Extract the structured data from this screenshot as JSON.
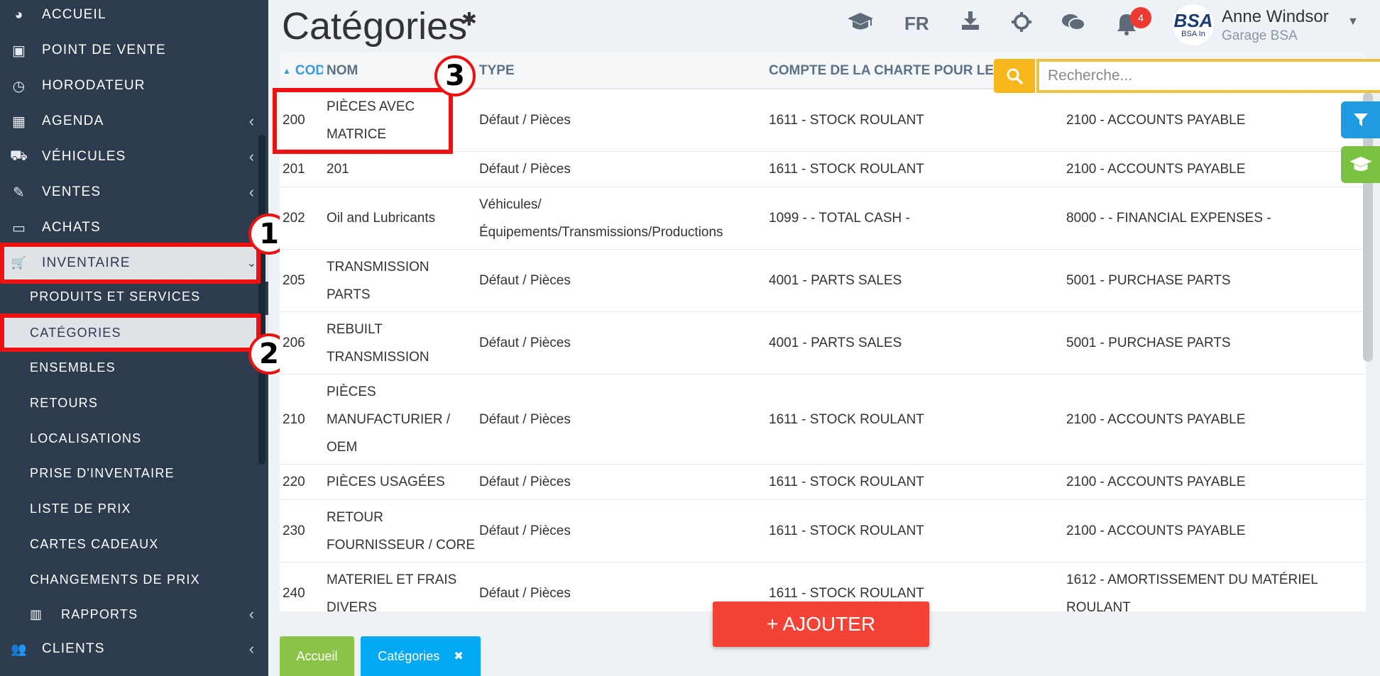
{
  "sidebar": {
    "items": [
      {
        "label": "ACCUEIL",
        "icon": "dashboard-icon",
        "glyph": "◕"
      },
      {
        "label": "POINT DE VENTE",
        "icon": "cash-icon",
        "glyph": "▣"
      },
      {
        "label": "HORODATEUR",
        "icon": "clock-icon",
        "glyph": "◷"
      },
      {
        "label": "AGENDA",
        "icon": "calendar-icon",
        "glyph": "▦"
      },
      {
        "label": "VÉHICULES",
        "icon": "car-icon",
        "glyph": "⛟"
      },
      {
        "label": "VENTES",
        "icon": "edit-icon",
        "glyph": "✎"
      },
      {
        "label": "ACHATS",
        "icon": "credit-card-icon",
        "glyph": "▭"
      },
      {
        "label": "INVENTAIRE",
        "icon": "cart-icon",
        "glyph": "🛒"
      }
    ],
    "sub_items": [
      "PRODUITS ET SERVICES",
      "CATÉGORIES",
      "ENSEMBLES",
      "RETOURS",
      "LOCALISATIONS",
      "PRISE D'INVENTAIRE",
      "LISTE DE PRIX",
      "CARTES CADEAUX",
      "CHANGEMENTS DE PRIX"
    ],
    "reports": {
      "label": "RAPPORTS",
      "icon": "bar-chart-icon",
      "glyph": "▥"
    },
    "clients": {
      "label": "CLIENTS",
      "icon": "users-icon",
      "glyph": "👥"
    }
  },
  "callouts": [
    "1",
    "2",
    "3"
  ],
  "header": {
    "title": "Catégories",
    "lang": "FR",
    "notification_count": "4",
    "user_name": "Anne Windsor",
    "company": "Garage BSA",
    "avatar_text_1": "BSA",
    "avatar_text_2": "BSA In"
  },
  "search": {
    "placeholder": "Recherche..."
  },
  "table": {
    "columns": [
      "CODE",
      "NOM",
      "TYPE",
      "COMPTE DE LA CHARTE POUR LES"
    ],
    "rows": [
      {
        "code": "200",
        "nom": [
          "PIÈCES AVEC",
          "MATRICE"
        ],
        "type": [
          "Défaut / Pièces"
        ],
        "compte1": "1611 - STOCK ROULANT",
        "compte2": [
          "2100 - ACCOUNTS PAYABLE"
        ]
      },
      {
        "code": "201",
        "nom": [
          "201"
        ],
        "type": [
          "Défaut / Pièces"
        ],
        "compte1": "1611 - STOCK ROULANT",
        "compte2": [
          "2100 - ACCOUNTS PAYABLE"
        ]
      },
      {
        "code": "202",
        "nom": [
          "Oil and Lubricants"
        ],
        "type": [
          "Véhicules/",
          "Équipements/Transmissions/Productions"
        ],
        "compte1": "1099 - - TOTAL CASH -",
        "compte2": [
          "8000 - - FINANCIAL EXPENSES -"
        ]
      },
      {
        "code": "205",
        "nom": [
          "TRANSMISSION",
          "PARTS"
        ],
        "type": [
          "Défaut / Pièces"
        ],
        "compte1": "4001 - PARTS SALES",
        "compte2": [
          "5001 - PURCHASE PARTS"
        ]
      },
      {
        "code": "206",
        "nom": [
          "REBUILT",
          "TRANSMISSION"
        ],
        "type": [
          "Défaut / Pièces"
        ],
        "compte1": "4001 - PARTS SALES",
        "compte2": [
          "5001 - PURCHASE PARTS"
        ]
      },
      {
        "code": "210",
        "nom": [
          "PIÈCES",
          "MANUFACTURIER /",
          "OEM"
        ],
        "type": [
          "Défaut / Pièces"
        ],
        "compte1": "1611 - STOCK ROULANT",
        "compte2": [
          "2100 - ACCOUNTS PAYABLE"
        ]
      },
      {
        "code": "220",
        "nom": [
          "PIÈCES USAGÉES"
        ],
        "type": [
          "Défaut / Pièces"
        ],
        "compte1": "1611 - STOCK ROULANT",
        "compte2": [
          "2100 - ACCOUNTS PAYABLE"
        ]
      },
      {
        "code": "230",
        "nom": [
          "RETOUR",
          "FOURNISSEUR / CORE"
        ],
        "type": [
          "Défaut / Pièces"
        ],
        "compte1": "1611 - STOCK ROULANT",
        "compte2": [
          "2100 - ACCOUNTS PAYABLE"
        ]
      },
      {
        "code": "240",
        "nom": [
          "MATERIEL ET FRAIS",
          "DIVERS"
        ],
        "type": [
          "Défaut / Pièces"
        ],
        "compte1": "1611 - STOCK ROULANT",
        "compte2": [
          "1612 - AMORTISSEMENT DU MATÉRIEL",
          "ROULANT"
        ]
      }
    ]
  },
  "add_button": "+ AJOUTER",
  "bottom_tabs": [
    {
      "label": "Accueil",
      "color": "#8bc34a"
    },
    {
      "label": "Catégories",
      "color": "#03a9f4",
      "close": "✖"
    }
  ],
  "colors": {
    "sidebar": "#2c3b4e",
    "highlight": "#ee1111",
    "search": "#f7b81e",
    "add": "#f24336",
    "filter": "#1e9be0",
    "tutorial": "#7cc242"
  }
}
